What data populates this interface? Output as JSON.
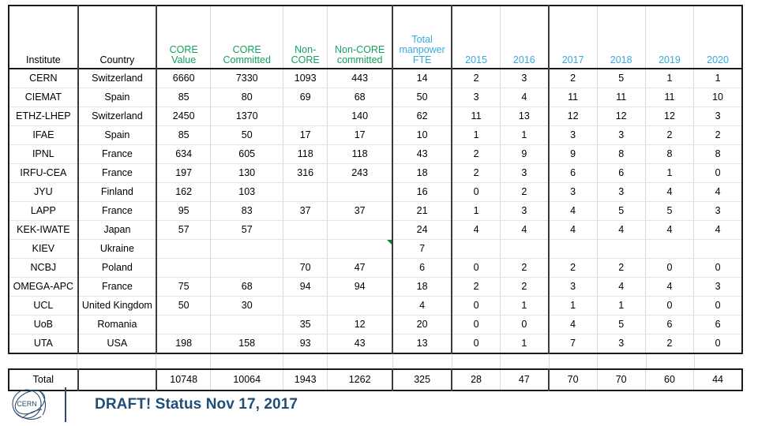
{
  "table": {
    "columns": [
      {
        "key": "institute",
        "label": "Institute",
        "label_lines": [
          "Institute"
        ],
        "color": "black"
      },
      {
        "key": "country",
        "label": "Country",
        "label_lines": [
          "Country"
        ],
        "color": "black"
      },
      {
        "key": "core_value",
        "label": "CORE Value",
        "label_lines": [
          "CORE",
          "Value"
        ],
        "color": "green"
      },
      {
        "key": "core_committed",
        "label": "CORE Committed",
        "label_lines": [
          "CORE",
          "Committed"
        ],
        "color": "green"
      },
      {
        "key": "non_core",
        "label": "Non-CORE",
        "label_lines": [
          "Non-",
          "CORE"
        ],
        "color": "green"
      },
      {
        "key": "non_core_committed",
        "label": "Non-CORE committed",
        "label_lines": [
          "Non-CORE",
          "committed"
        ],
        "color": "green"
      },
      {
        "key": "total_fte",
        "label": "Total manpower FTE",
        "label_lines": [
          "Total",
          "manpower",
          "FTE"
        ],
        "color": "blue"
      },
      {
        "key": "y2015",
        "label": "2015",
        "label_lines": [
          "2015"
        ],
        "color": "blue"
      },
      {
        "key": "y2016",
        "label": "2016",
        "label_lines": [
          "2016"
        ],
        "color": "blue"
      },
      {
        "key": "y2017",
        "label": "2017",
        "label_lines": [
          "2017"
        ],
        "color": "blue"
      },
      {
        "key": "y2018",
        "label": "2018",
        "label_lines": [
          "2018"
        ],
        "color": "blue"
      },
      {
        "key": "y2019",
        "label": "2019",
        "label_lines": [
          "2019"
        ],
        "color": "blue"
      },
      {
        "key": "y2020",
        "label": "2020",
        "label_lines": [
          "2020"
        ],
        "color": "blue"
      }
    ],
    "rows": [
      {
        "institute": "CERN",
        "country": "Switzerland",
        "core_value": "6660",
        "core_committed": "7330",
        "non_core": "1093",
        "non_core_committed": "443",
        "total_fte": "14",
        "y2015": "2",
        "y2016": "3",
        "y2017": "2",
        "y2018": "5",
        "y2019": "1",
        "y2020": "1"
      },
      {
        "institute": "CIEMAT",
        "country": "Spain",
        "core_value": "85",
        "core_committed": "80",
        "non_core": "69",
        "non_core_committed": "68",
        "total_fte": "50",
        "y2015": "3",
        "y2016": "4",
        "y2017": "11",
        "y2018": "11",
        "y2019": "11",
        "y2020": "10"
      },
      {
        "institute": "ETHZ-LHEP",
        "country": "Switzerland",
        "core_value": "2450",
        "core_committed": "1370",
        "non_core": "",
        "non_core_committed": "140",
        "total_fte": "62",
        "y2015": "11",
        "y2016": "13",
        "y2017": "12",
        "y2018": "12",
        "y2019": "12",
        "y2020": "3"
      },
      {
        "institute": "IFAE",
        "country": "Spain",
        "core_value": "85",
        "core_committed": "50",
        "non_core": "17",
        "non_core_committed": "17",
        "total_fte": "10",
        "y2015": "1",
        "y2016": "1",
        "y2017": "3",
        "y2018": "3",
        "y2019": "2",
        "y2020": "2"
      },
      {
        "institute": "IPNL",
        "country": "France",
        "core_value": "634",
        "core_committed": "605",
        "non_core": "118",
        "non_core_committed": "118",
        "total_fte": "43",
        "y2015": "2",
        "y2016": "9",
        "y2017": "9",
        "y2018": "8",
        "y2019": "8",
        "y2020": "8"
      },
      {
        "institute": "IRFU-CEA",
        "country": "France",
        "core_value": "197",
        "core_committed": "130",
        "non_core": "316",
        "non_core_committed": "243",
        "total_fte": "18",
        "y2015": "2",
        "y2016": "3",
        "y2017": "6",
        "y2018": "6",
        "y2019": "1",
        "y2020": "0"
      },
      {
        "institute": "JYU",
        "country": "Finland",
        "core_value": "162",
        "core_committed": "103",
        "non_core": "",
        "non_core_committed": "",
        "total_fte": "16",
        "y2015": "0",
        "y2016": "2",
        "y2017": "3",
        "y2018": "3",
        "y2019": "4",
        "y2020": "4"
      },
      {
        "institute": "LAPP",
        "country": "France",
        "core_value": "95",
        "core_committed": "83",
        "non_core": "37",
        "non_core_committed": "37",
        "total_fte": "21",
        "y2015": "1",
        "y2016": "3",
        "y2017": "4",
        "y2018": "5",
        "y2019": "5",
        "y2020": "3"
      },
      {
        "institute": "KEK-IWATE",
        "country": "Japan",
        "core_value": "57",
        "core_committed": "57",
        "non_core": "",
        "non_core_committed": "",
        "total_fte": "24",
        "y2015": "4",
        "y2016": "4",
        "y2017": "4",
        "y2018": "4",
        "y2019": "4",
        "y2020": "4"
      },
      {
        "institute": "KIEV",
        "country": "Ukraine",
        "core_value": "",
        "core_committed": "",
        "non_core": "",
        "non_core_committed": "",
        "total_fte": "7",
        "y2015": "",
        "y2016": "",
        "y2017": "",
        "y2018": "",
        "y2019": "",
        "y2020": "",
        "comment_marker_on": "non_core_committed"
      },
      {
        "institute": "NCBJ",
        "country": "Poland",
        "core_value": "",
        "core_committed": "",
        "non_core": "70",
        "non_core_committed": "47",
        "total_fte": "6",
        "y2015": "0",
        "y2016": "2",
        "y2017": "2",
        "y2018": "2",
        "y2019": "0",
        "y2020": "0"
      },
      {
        "institute": "OMEGA-APC",
        "country": "France",
        "core_value": "75",
        "core_committed": "68",
        "non_core": "94",
        "non_core_committed": "94",
        "total_fte": "18",
        "y2015": "2",
        "y2016": "2",
        "y2017": "3",
        "y2018": "4",
        "y2019": "4",
        "y2020": "3"
      },
      {
        "institute": "UCL",
        "country": "United Kingdom",
        "core_value": "50",
        "core_committed": "30",
        "non_core": "",
        "non_core_committed": "",
        "total_fte": "4",
        "y2015": "0",
        "y2016": "1",
        "y2017": "1",
        "y2018": "1",
        "y2019": "0",
        "y2020": "0"
      },
      {
        "institute": "UoB",
        "country": "Romania",
        "core_value": "",
        "core_committed": "",
        "non_core": "35",
        "non_core_committed": "12",
        "total_fte": "20",
        "y2015": "0",
        "y2016": "0",
        "y2017": "4",
        "y2018": "5",
        "y2019": "6",
        "y2020": "6"
      },
      {
        "institute": "UTA",
        "country": "USA",
        "core_value": "198",
        "core_committed": "158",
        "non_core": "93",
        "non_core_committed": "43",
        "total_fte": "13",
        "y2015": "0",
        "y2016": "1",
        "y2017": "7",
        "y2018": "3",
        "y2019": "2",
        "y2020": "0"
      }
    ],
    "total_row": {
      "institute": "Total",
      "country": "",
      "core_value": "10748",
      "core_committed": "10064",
      "non_core": "1943",
      "non_core_committed": "1262",
      "total_fte": "325",
      "y2015": "28",
      "y2016": "47",
      "y2017": "70",
      "y2018": "70",
      "y2019": "60",
      "y2020": "44"
    }
  },
  "footer": {
    "logo_text": "CERN",
    "status_text": "DRAFT! Status Nov 17, 2017"
  },
  "colors": {
    "header_green": "#17a05c",
    "header_blue": "#36a9dd",
    "footer_blue": "#1f4e79",
    "comment_marker_green": "#1f7a3d",
    "grid_line": "#d9d9d9",
    "rule_dark": "#1a1a1a"
  }
}
